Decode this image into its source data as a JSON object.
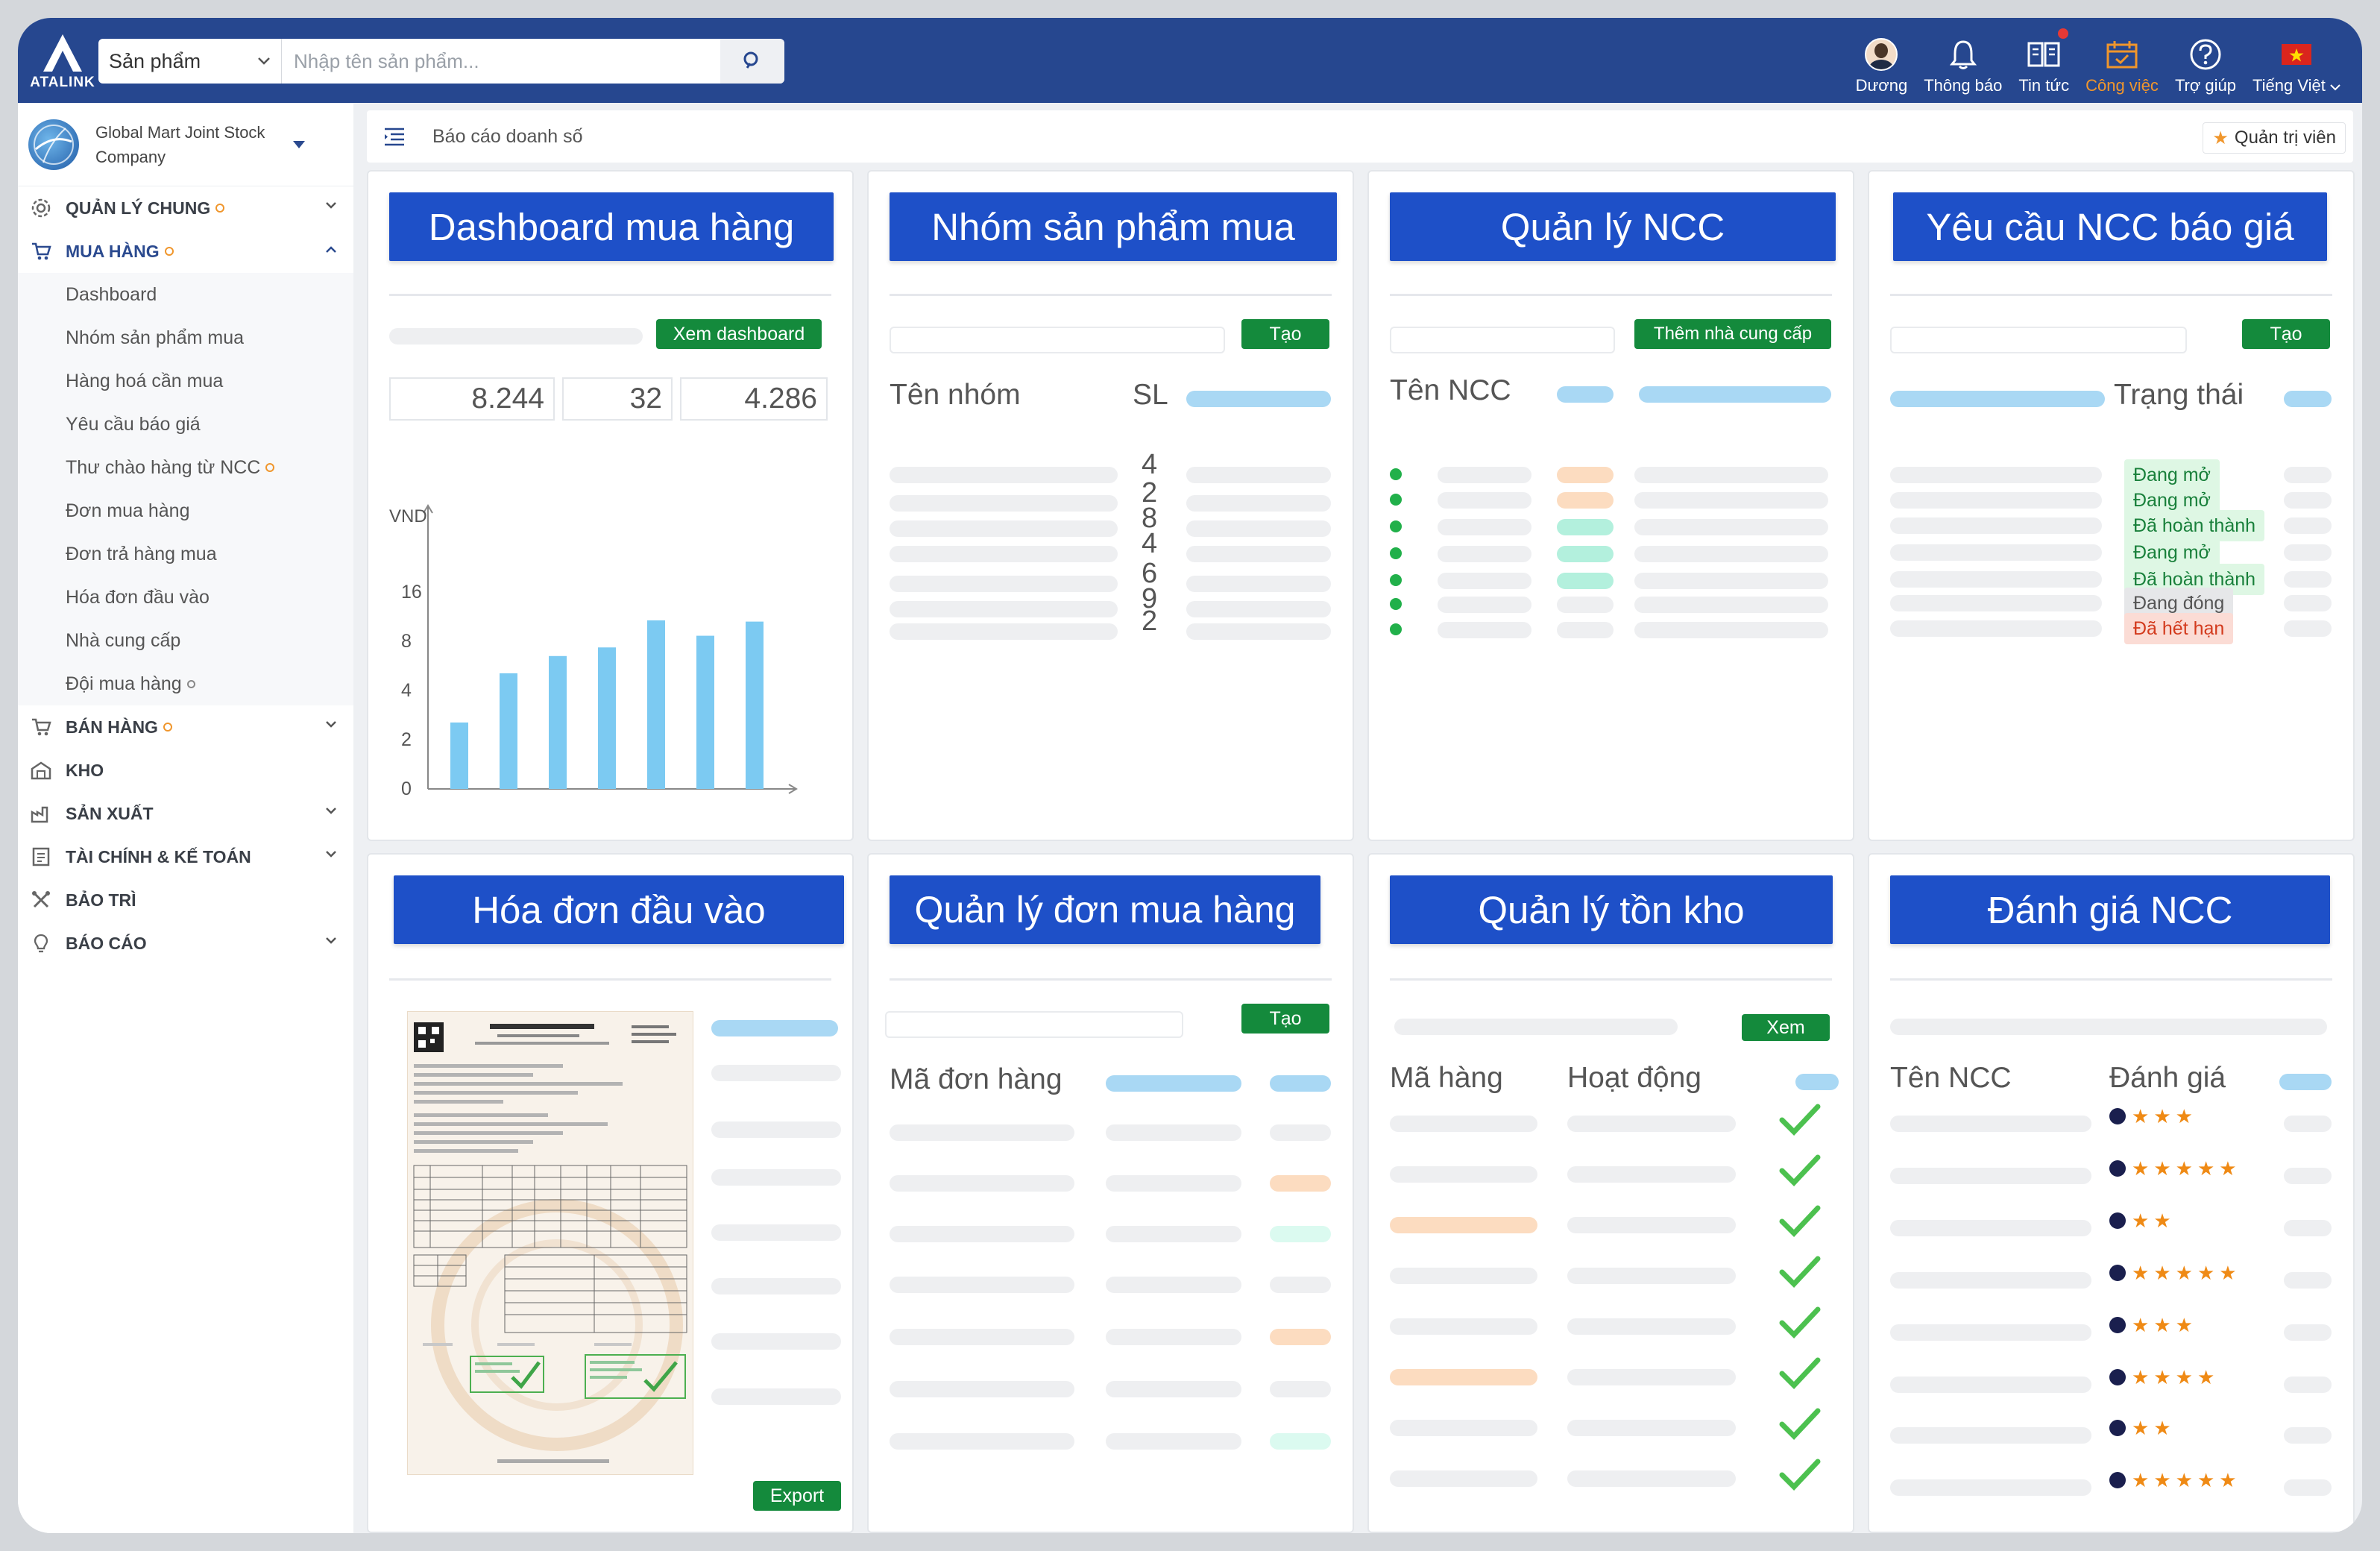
{
  "topbar": {
    "logo_text": "ATALINK",
    "search_category": "Sản phẩm",
    "search_placeholder": "Nhập tên sản phẩm...",
    "items": [
      {
        "label": "Dương"
      },
      {
        "label": "Thông báo"
      },
      {
        "label": "Tin tức"
      },
      {
        "label": "Công việc"
      },
      {
        "label": "Trợ giúp"
      },
      {
        "label": "Tiếng Việt"
      }
    ]
  },
  "sidebar": {
    "company": "Global Mart Joint Stock Company",
    "menu": {
      "quan_ly_chung": "QUẢN LÝ CHUNG",
      "mua_hang": "MUA HÀNG",
      "ban_hang": "BÁN HÀNG",
      "kho": "KHO",
      "san_xuat": "SẢN XUẤT",
      "tai_chinh": "TÀI CHÍNH & KẾ TOÁN",
      "bao_tri": "BẢO TRÌ",
      "bao_cao": "BÁO CÁO"
    },
    "submenu": [
      "Dashboard",
      "Nhóm sản phẩm mua",
      "Hàng hoá cần mua",
      "Yêu cầu báo giá",
      "Thư chào hàng từ NCC",
      "Đơn mua hàng",
      "Đơn trả hàng mua",
      "Hóa đơn đầu vào",
      "Nhà cung cấp",
      "Đội mua hàng"
    ]
  },
  "breadcrumb": {
    "title": "Báo cáo doanh số",
    "admin_button": "Quản trị viên"
  },
  "cards": {
    "dashboard": {
      "title": "Dashboard mua hàng",
      "button": "Xem dashboard",
      "stats": [
        "8.244",
        "32",
        "4.286"
      ],
      "y_unit": "VND"
    },
    "nhom_sp": {
      "title": "Nhóm sản phẩm mua",
      "button": "Tạo",
      "col_name": "Tên nhóm",
      "col_sl": "SL",
      "counts": [
        "4",
        "2",
        "8",
        "4",
        "6",
        "9",
        "2"
      ]
    },
    "ncc": {
      "title": "Quản lý NCC",
      "button": "Thêm nhà cung cấp",
      "col_name": "Tên NCC"
    },
    "bao_gia": {
      "title": "Yêu cầu NCC báo giá",
      "button": "Tạo",
      "col_status": "Trạng thái",
      "statuses": [
        "Đang mở",
        "Đang mở",
        "Đã hoàn thành",
        "Đang mở",
        "Đã hoàn thành",
        "Đang đóng",
        "Đã hết hạn"
      ]
    },
    "hoa_don": {
      "title": "Hóa đơn đầu vào",
      "button": "Export"
    },
    "don_mua": {
      "title": "Quản lý đơn mua hàng",
      "button": "Tạo",
      "col_code": "Mã đơn hàng"
    },
    "ton_kho": {
      "title": "Quản lý tồn kho",
      "button": "Xem",
      "col_code": "Mã hàng",
      "col_active": "Hoạt động"
    },
    "danh_gia": {
      "title": "Đánh giá NCC",
      "col_name": "Tên NCC",
      "col_rating": "Đánh giá",
      "ratings": [
        3,
        5,
        2,
        5,
        3,
        4,
        2,
        5
      ]
    }
  },
  "chart_data": {
    "type": "bar",
    "ylabel": "VND",
    "yticks": [
      0,
      2,
      4,
      8,
      16
    ],
    "values": [
      2.7,
      5.4,
      6.8,
      7.5,
      11.4,
      8.9,
      11.2
    ],
    "color": "#7ccaf2"
  },
  "colors": {
    "topbar": "#26478f",
    "title_blue": "#1e50c8",
    "green_button": "#148a3c",
    "accent_orange": "#f0962c"
  }
}
